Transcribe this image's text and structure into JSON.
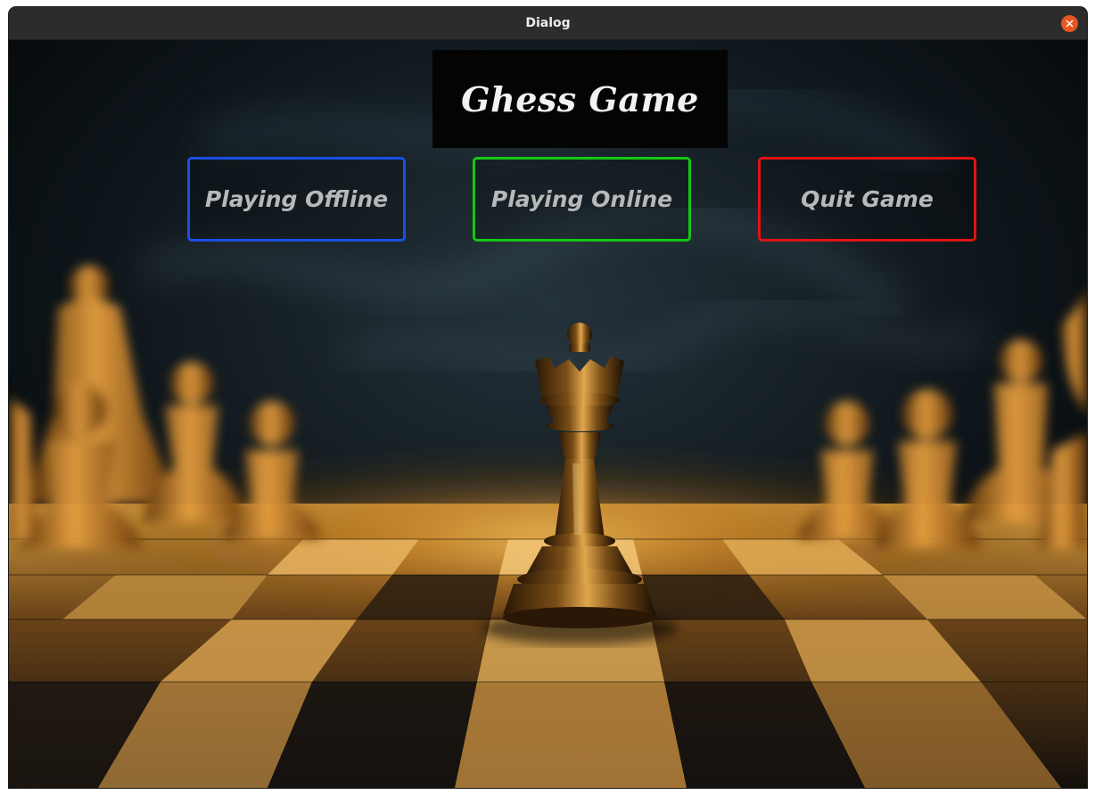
{
  "window": {
    "title": "Dialog"
  },
  "header": {
    "title": "Ghess Game"
  },
  "menu": {
    "offline_label": "Playing Offline",
    "online_label": "Playing Online",
    "quit_label": "Quit Game"
  },
  "colors": {
    "offline_border": "#1a4fe6",
    "online_border": "#14c814",
    "quit_border": "#e01414",
    "close_button": "#e95420",
    "titlebar": "#2c2c2c"
  },
  "icons": {
    "close": "close-icon",
    "background": "chess-queen-on-board"
  }
}
